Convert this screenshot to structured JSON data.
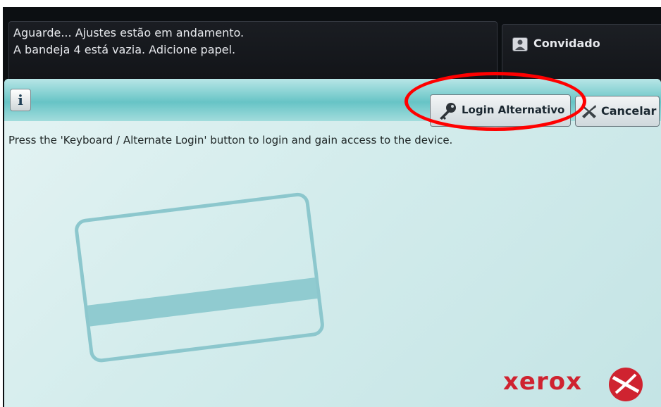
{
  "status": {
    "line1": "Aguarde... Ajustes estão em andamento.",
    "line2": "A bandeja 4 está vazia.  Adicione papel."
  },
  "user": {
    "label": "Convidado",
    "icon": "user-icon"
  },
  "toolbar": {
    "info_label": "i",
    "login_label": "Login Alternativo",
    "cancel_label": "Cancelar"
  },
  "main": {
    "instructions": "Press the 'Keyboard / Alternate Login' button to login and gain access to the device."
  },
  "brand": {
    "name": "xerox",
    "color": "#cf2330"
  },
  "annotation": {
    "color": "#ff0000"
  }
}
